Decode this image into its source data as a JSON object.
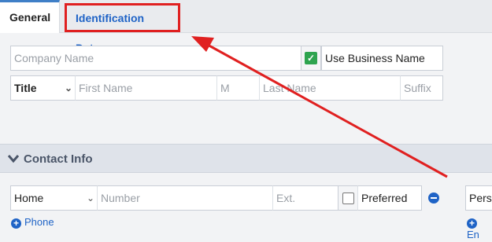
{
  "tabs": {
    "general": "General",
    "identification": "Identification Data"
  },
  "company": {
    "placeholder": "Company Name",
    "use_business_name": "Use Business Name",
    "use_business_name_checked": true
  },
  "name": {
    "title": "Title",
    "first": "First Name",
    "middle": "M",
    "last": "Last Name",
    "suffix": "Suffix"
  },
  "contact_info": {
    "heading": "Contact Info"
  },
  "phone_row": {
    "type": "Home",
    "number_placeholder": "Number",
    "ext_placeholder": "Ext.",
    "preferred_label": "Preferred",
    "preferred_checked": false,
    "add_phone": "Phone"
  },
  "right_partial": {
    "field_text": "Perso",
    "add_link": "En"
  },
  "colors": {
    "accent": "#1f63c6",
    "highlight": "#e02020",
    "check": "#2ea44f"
  }
}
